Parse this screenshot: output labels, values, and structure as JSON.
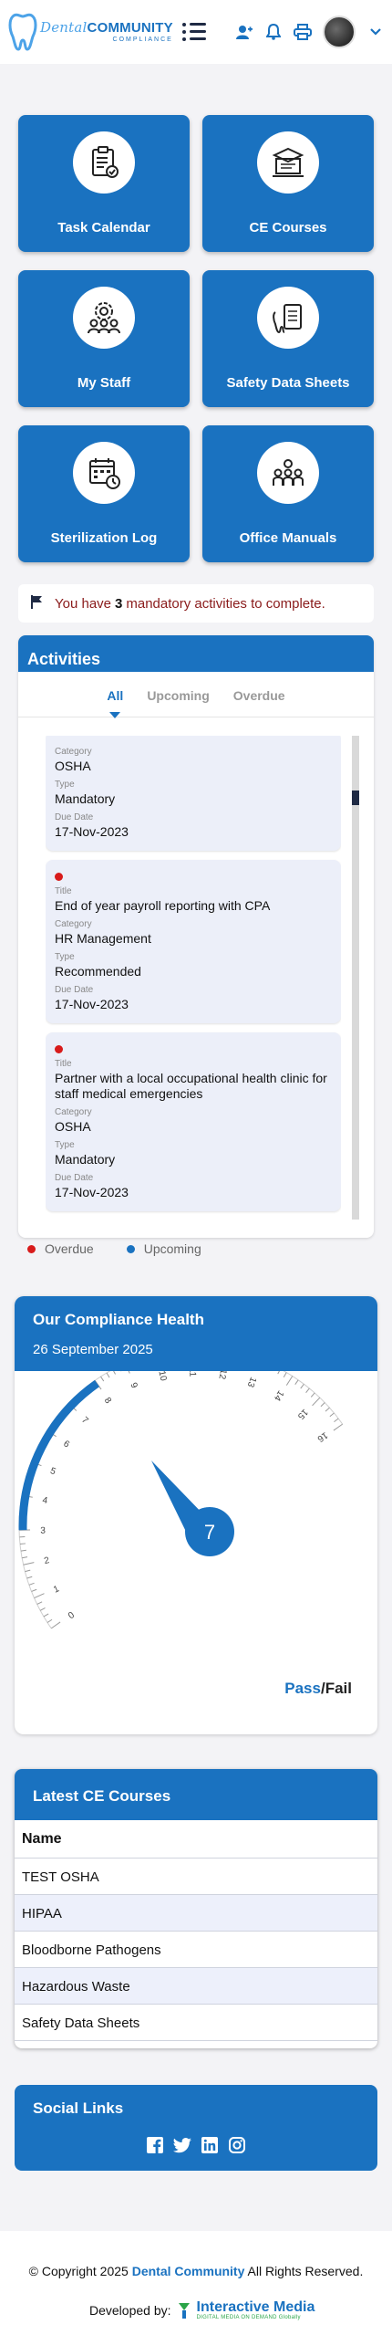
{
  "header": {
    "logo_script": "Dental",
    "logo_word": "COMMUNITY",
    "logo_sub": "COMPLIANCE",
    "icons": [
      "add-user-icon",
      "bell-icon",
      "printer-icon",
      "avatar",
      "chevron-down-icon"
    ]
  },
  "tiles": [
    {
      "label": "Task Calendar",
      "icon": "clipboard-check-icon"
    },
    {
      "label": "CE Courses",
      "icon": "certificate-monitor-icon"
    },
    {
      "label": "My Staff",
      "icon": "staff-gear-icon"
    },
    {
      "label": "Safety Data Sheets",
      "icon": "tooth-clipboard-icon"
    },
    {
      "label": "Sterilization Log",
      "icon": "calendar-log-icon"
    },
    {
      "label": "Office Manuals",
      "icon": "team-icon"
    }
  ],
  "notice": {
    "pre": "You have",
    "count": "3",
    "post": "mandatory activities to complete."
  },
  "activities": {
    "title": "Activities",
    "tabs": [
      "All",
      "Upcoming",
      "Overdue"
    ],
    "labels": {
      "title": "Title",
      "category": "Category",
      "type": "Type",
      "due": "Due Date"
    },
    "items": [
      {
        "title": "",
        "category": "OSHA",
        "type": "Mandatory",
        "due": "17-Nov-2023"
      },
      {
        "title": "End of year payroll reporting with CPA",
        "category": "HR Management",
        "type": "Recommended",
        "due": "17-Nov-2023"
      },
      {
        "title": "Partner with a local occupational health clinic for staff medical emergencies",
        "category": "OSHA",
        "type": "Mandatory",
        "due": "17-Nov-2023"
      }
    ],
    "legend": [
      {
        "label": "Overdue",
        "color": "#d81b1b"
      },
      {
        "label": "Upcoming",
        "color": "#1a72c0"
      }
    ]
  },
  "health": {
    "title": "Our Compliance Health",
    "date": "26 September 2025",
    "value": 7,
    "scale_min": 0,
    "scale_max": 16,
    "pass": "Pass",
    "slash": "/",
    "fail": "Fail"
  },
  "ce_courses": {
    "title": "Latest CE Courses",
    "column": "Name",
    "rows": [
      "TEST OSHA",
      "HIPAA",
      "Bloodborne Pathogens",
      "Hazardous Waste",
      "Safety Data Sheets"
    ]
  },
  "social": {
    "title": "Social Links",
    "icons": [
      "facebook-icon",
      "twitter-icon",
      "linkedin-icon",
      "instagram-icon"
    ]
  },
  "footer": {
    "copyright_pre": "© Copyright 2025",
    "brand": "Dental Community",
    "copyright_post": "All Rights Reserved.",
    "developed_by": "Developed by:",
    "dev_name": "Interactive Media",
    "dev_tagline": "DIGITAL MEDIA ON DEMAND Globally"
  },
  "colors": {
    "primary": "#1a72c0",
    "overdue": "#d81b1b",
    "notice_text": "#8a1b1b"
  }
}
